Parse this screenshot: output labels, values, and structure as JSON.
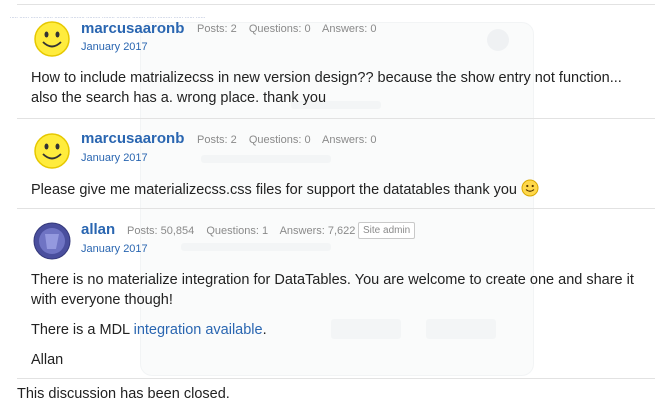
{
  "topbar": {
    "text": "..... ...... ....... ...... ......... ......... ......... ........ ......... ........ ...... ......... ...... ...... ......"
  },
  "posts": [
    {
      "author": "marcusaaronb",
      "stats": {
        "posts": "Posts: 2",
        "questions": "Questions: 0",
        "answers": "Answers: 0"
      },
      "date": "January 2017",
      "paragraphs": [
        "How to include matrializecss in new version design?? because the show entry not function... also the search has a. wrong place. thank you"
      ]
    },
    {
      "author": "marcusaaronb",
      "stats": {
        "posts": "Posts: 2",
        "questions": "Questions: 0",
        "answers": "Answers: 0"
      },
      "date": "January 2017",
      "paragraphs": [
        "Please give me materializecss.css files for support the datatables thank you"
      ]
    },
    {
      "author": "allan",
      "stats": {
        "posts": "Posts: 50,854",
        "questions": "Questions: 1",
        "answers": "Answers: 7,622"
      },
      "badge": "Site admin",
      "date": "January 2017",
      "paragraphs": [
        "There is no materialize integration for DataTables. You are welcome to create one and share it with everyone though!",
        "Allan"
      ],
      "mdl_prefix": "There is a MDL ",
      "mdl_link": "integration available",
      "mdl_suffix": "."
    }
  ],
  "footer": {
    "closed": "This discussion has been closed."
  },
  "colors": {
    "link": "#2a66b1",
    "meta": "#8a8a8a",
    "divider": "#e2e2e2",
    "avatar_bg": "#4a4f9e"
  }
}
